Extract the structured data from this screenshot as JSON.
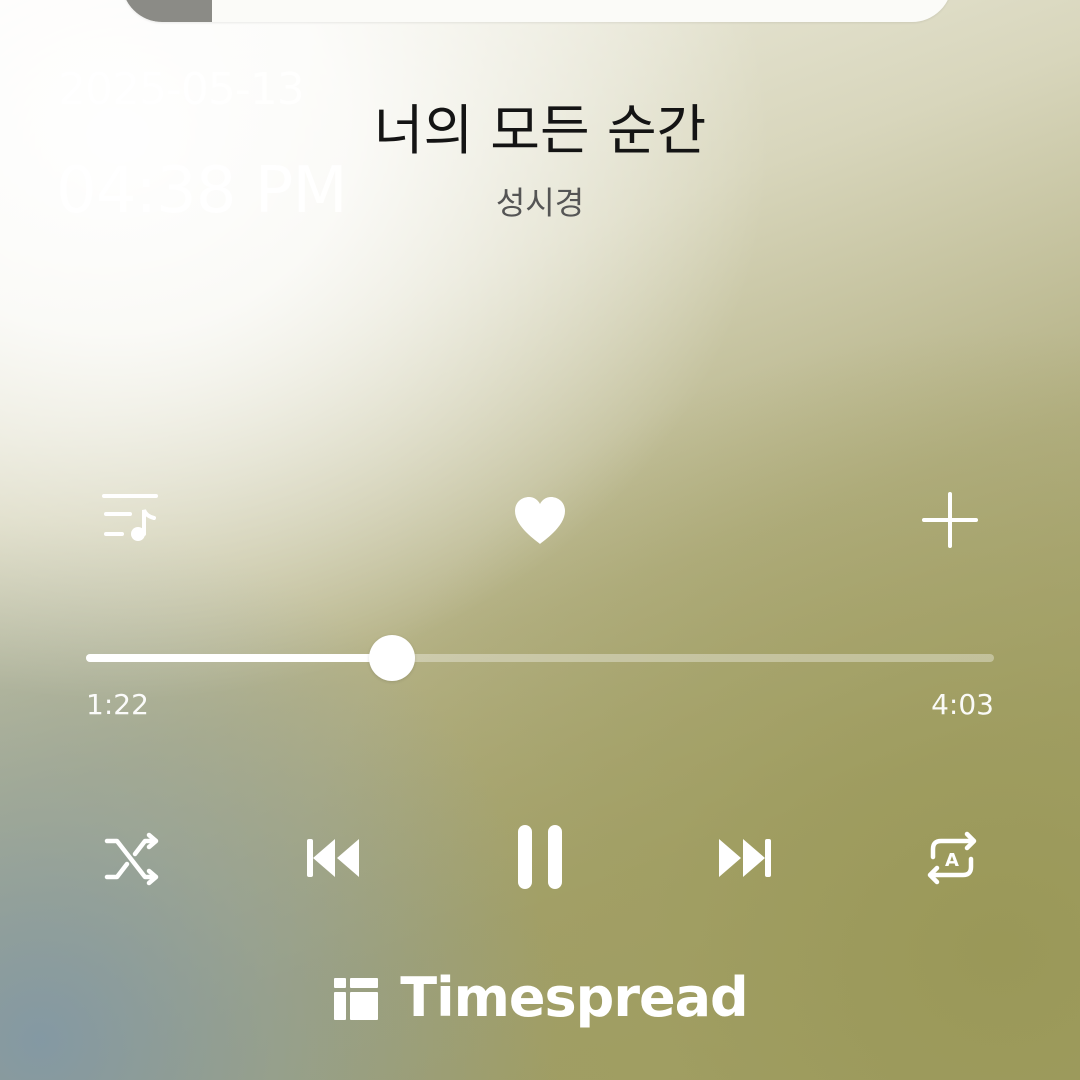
{
  "status": {
    "date": "2025-05-13",
    "time": "04:38 PM"
  },
  "track": {
    "title": "너의 모든 순간",
    "artist": "성시경",
    "liked": true
  },
  "progress": {
    "elapsed": "1:22",
    "total": "4:03",
    "fraction": 0.3374
  },
  "actions": {
    "playlist_icon": "queue-music-icon",
    "like_icon": "heart-icon",
    "add_icon": "plus-icon"
  },
  "controls": {
    "shuffle_icon": "shuffle-icon",
    "previous_icon": "skip-previous-icon",
    "pause_icon": "pause-icon",
    "next_icon": "skip-next-icon",
    "repeat_icon": "repeat-a-icon",
    "repeat_letter": "A"
  },
  "brand": {
    "name": "Timespread"
  },
  "colors": {
    "icon": "#ffffff",
    "title": "#141414",
    "artist": "#555555"
  }
}
